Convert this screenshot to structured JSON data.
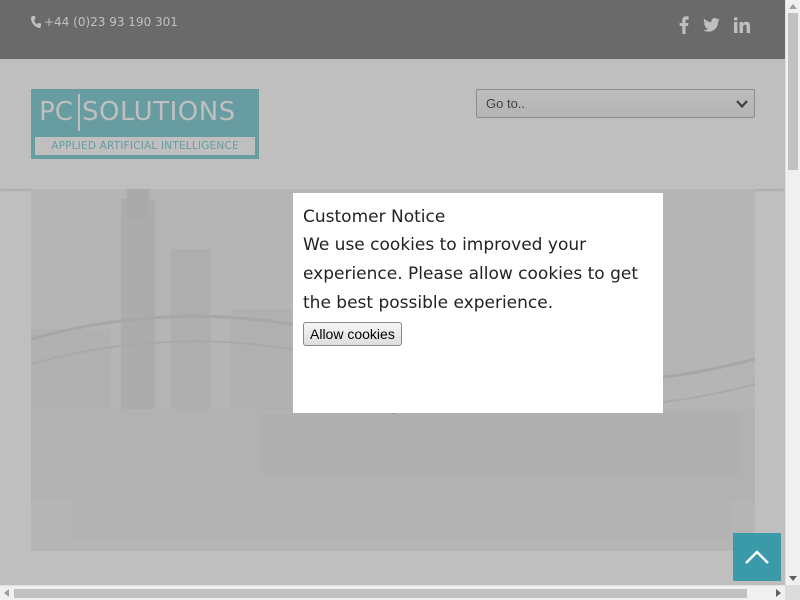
{
  "topbar": {
    "phone": "+44 (0)23 93 190 301",
    "social": [
      "facebook-icon",
      "twitter-icon",
      "linkedin-icon"
    ]
  },
  "header": {
    "logo_pc": "PC",
    "logo_solutions": "SOLUTIONS",
    "logo_tagline": "APPLIED ARTIFICIAL INTELLIGENCE",
    "goto_selected": "Go to.."
  },
  "cookie_notice": {
    "title": "Customer Notice",
    "body": "We use cookies to improved your experience. Please allow cookies to get the best possible experience.",
    "button": "Allow cookies"
  },
  "colors": {
    "topbar": "#555555",
    "brand": "#4fb8c2",
    "scroll_top": "#3a9aa8"
  }
}
